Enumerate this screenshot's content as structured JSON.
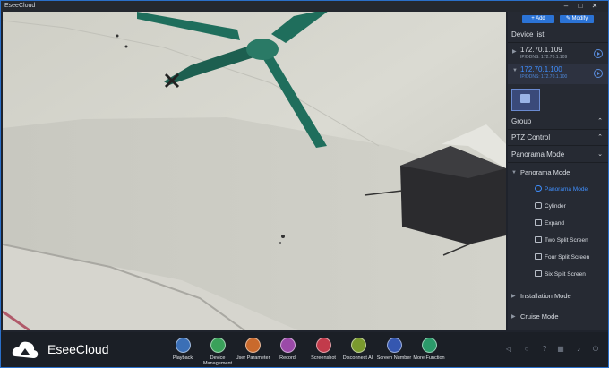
{
  "app": {
    "title": "EseeCloud"
  },
  "sidebar": {
    "add_label": "+ Add",
    "modify_label": "Modify",
    "device_list_label": "Device list",
    "devices": [
      {
        "ip": "172.70.1.109",
        "sub": "IP/DDNS: 172.70.1.109"
      },
      {
        "ip": "172.70.1.100",
        "sub": "IP/DDNS: 172.70.1.100"
      }
    ],
    "group_label": "Group",
    "ptz_label": "PTZ Control",
    "panorama_label": "Panorama Mode",
    "panorama_sub_header": "Panorama Mode",
    "modes": [
      "Panorama Mode",
      "Cylinder",
      "Expand",
      "Two Split Screen",
      "Four Split Screen",
      "Six Split Screen"
    ],
    "installation_label": "Installation Mode",
    "cruise_label": "Cruise Mode"
  },
  "toolbar": {
    "logo": "EseeCloud",
    "items": [
      {
        "label": "Playback",
        "color": "#3b6fb6",
        "icon": "playback-icon"
      },
      {
        "label": "Device Management",
        "color": "#3aa15a",
        "icon": "device-management-icon"
      },
      {
        "label": "User Parameter",
        "color": "#c96a2d",
        "icon": "user-parameter-icon"
      },
      {
        "label": "Record",
        "color": "#9b4aa8",
        "icon": "record-icon"
      },
      {
        "label": "Screenshot",
        "color": "#c23b4b",
        "icon": "screenshot-icon"
      },
      {
        "label": "Disconnect All",
        "color": "#7a9a2e",
        "icon": "disconnect-all-icon"
      },
      {
        "label": "Screen Number",
        "color": "#3557b0",
        "icon": "screen-number-icon"
      },
      {
        "label": "More Function",
        "color": "#2b9a6a",
        "icon": "more-function-icon"
      }
    ]
  }
}
